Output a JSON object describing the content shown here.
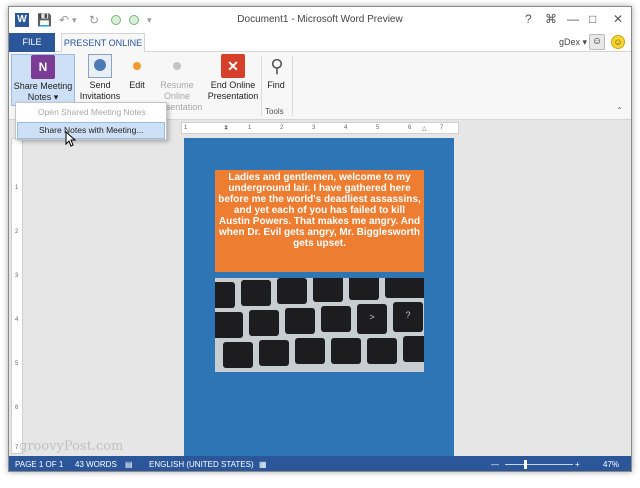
{
  "window": {
    "title": "Document1 - Microsoft Word Preview",
    "help": "?",
    "restore_ribbon": "⌘",
    "minimize": "—",
    "maximize": "□",
    "close": "✕"
  },
  "quick_access": {
    "app_icon": "W",
    "save": "💾",
    "undo": "↶",
    "undo_dropdown": "▾",
    "redo": "↻",
    "customize": "▾"
  },
  "tabs": {
    "file": "FILE",
    "present_online": "PRESENT ONLINE"
  },
  "user": {
    "name": "gDex",
    "dropdown": "▾"
  },
  "ribbon": {
    "share_meeting_notes": "Share Meeting",
    "share_meeting_notes_2": "Notes",
    "send_invitations": "Send",
    "send_invitations_2": "Invitations",
    "edit": "Edit",
    "resume_online": "Resume Online",
    "resume_online_2": "Presentation",
    "end_online": "End Online",
    "end_online_2": "Presentation",
    "find": "Find",
    "tools_group": "Tools",
    "onenote_icon": "N",
    "end_icon": "✕",
    "find_icon": "⚲"
  },
  "dropdown": {
    "open_shared": "Open Shared Meeting Notes",
    "share_with_meeting": "Share Notes with Meeting..."
  },
  "rulers": {
    "h_ticks": [
      "1",
      "1",
      "2",
      "3",
      "4",
      "5",
      "6",
      "7"
    ],
    "v_ticks": [
      "1",
      "2",
      "3",
      "4",
      "5",
      "6",
      "7"
    ]
  },
  "document": {
    "text": "Ladies and gentlemen, welcome to my underground lair. I have gathered here before me the world's deadliest assassins, and yet each of you has failed to kill Austin Powers. That makes me angry. And when Dr. Evil gets angry, Mr. Bigglesworth gets upset.",
    "keys": [
      "",
      "",
      "",
      "",
      "",
      "",
      "",
      "",
      "",
      "",
      ">",
      "?",
      "",
      "",
      "",
      "",
      "",
      ""
    ],
    "watermark": "groovyPost.com"
  },
  "status": {
    "page": "PAGE 1 OF 1",
    "words": "43 WORDS",
    "language": "ENGLISH (UNITED STATES)",
    "zoom_minus": "—",
    "zoom_plus": "+",
    "zoom": "47%"
  },
  "colors": {
    "word_blue": "#2b579a",
    "page_blue": "#2e75b6",
    "textbox_orange": "#ed7d31"
  }
}
